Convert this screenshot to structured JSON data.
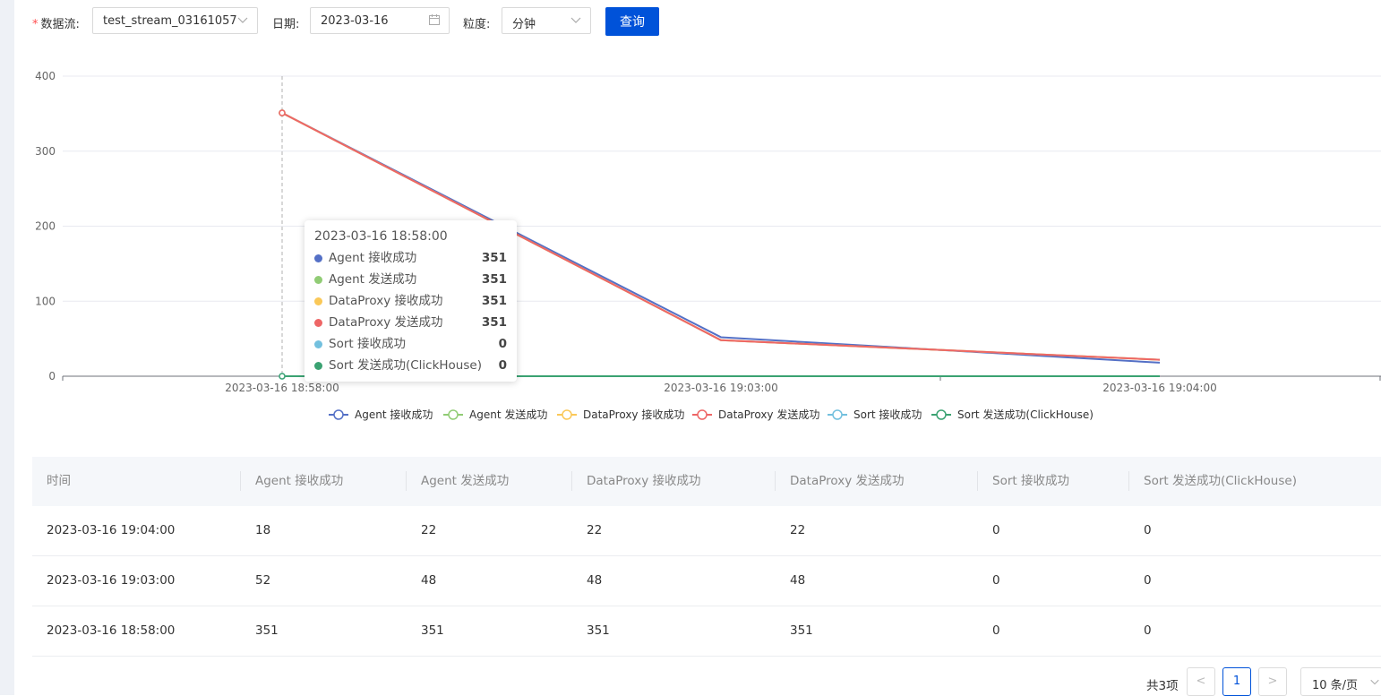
{
  "filters": {
    "stream_label": "数据流",
    "stream_value": "test_stream_03161057",
    "date_label": "日期",
    "date_value": "2023-03-16",
    "granularity_label": "粒度",
    "granularity_value": "分钟",
    "query_button": "查询",
    "colon": ":"
  },
  "chart_data": {
    "type": "line",
    "title": "",
    "xlabel": "",
    "ylabel": "",
    "categories": [
      "2023-03-16 18:58:00",
      "2023-03-16 19:03:00",
      "2023-03-16 19:04:00"
    ],
    "ylim": [
      0,
      400
    ],
    "yticks": [
      0,
      100,
      200,
      300,
      400
    ],
    "grid": true,
    "legend_position": "bottom",
    "series": [
      {
        "name": "Agent 接收成功",
        "color": "#5470c6",
        "values": [
          351,
          52,
          18
        ]
      },
      {
        "name": "Agent 发送成功",
        "color": "#91cc75",
        "values": [
          351,
          48,
          22
        ]
      },
      {
        "name": "DataProxy 接收成功",
        "color": "#fac858",
        "values": [
          351,
          48,
          22
        ]
      },
      {
        "name": "DataProxy 发送成功",
        "color": "#ee6666",
        "values": [
          351,
          48,
          22
        ]
      },
      {
        "name": "Sort 接收成功",
        "color": "#73c0de",
        "values": [
          0,
          0,
          0
        ]
      },
      {
        "name": "Sort 发送成功(ClickHouse)",
        "color": "#3ba272",
        "values": [
          0,
          0,
          0
        ]
      }
    ],
    "tooltip": {
      "title": "2023-03-16 18:58:00",
      "rows": [
        {
          "name": "Agent 接收成功",
          "value": "351",
          "color": "#5470c6"
        },
        {
          "name": "Agent 发送成功",
          "value": "351",
          "color": "#91cc75"
        },
        {
          "name": "DataProxy 接收成功",
          "value": "351",
          "color": "#fac858"
        },
        {
          "name": "DataProxy 发送成功",
          "value": "351",
          "color": "#ee6666"
        },
        {
          "name": "Sort 接收成功",
          "value": "0",
          "color": "#73c0de"
        },
        {
          "name": "Sort 发送成功(ClickHouse)",
          "value": "0",
          "color": "#3ba272"
        }
      ]
    }
  },
  "table": {
    "columns": [
      "时间",
      "Agent 接收成功",
      "Agent 发送成功",
      "DataProxy 接收成功",
      "DataProxy 发送成功",
      "Sort 接收成功",
      "Sort 发送成功(ClickHouse)"
    ],
    "rows": [
      [
        "2023-03-16 19:04:00",
        "18",
        "22",
        "22",
        "22",
        "0",
        "0"
      ],
      [
        "2023-03-16 19:03:00",
        "52",
        "48",
        "48",
        "48",
        "0",
        "0"
      ],
      [
        "2023-03-16 18:58:00",
        "351",
        "351",
        "351",
        "351",
        "0",
        "0"
      ]
    ]
  },
  "pagination": {
    "total": "共3项",
    "prev": "<",
    "page": "1",
    "next": ">",
    "page_size": "10 条/页"
  },
  "icons": {
    "calendar": "calendar-icon",
    "chevron": "chevron-down-icon"
  }
}
